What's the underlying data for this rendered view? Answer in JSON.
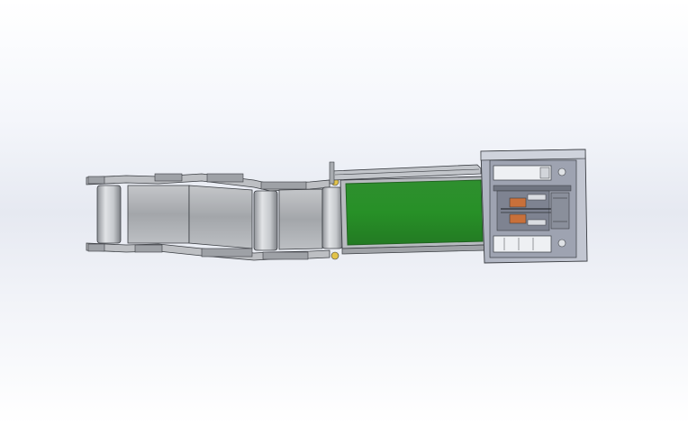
{
  "viewport": {
    "kind": "3d-cad-graphics-area",
    "background": [
      "#ffffff",
      "#e6e9f1"
    ]
  },
  "model": {
    "component_names": [
      "conveyor-frame",
      "roller-belt-section",
      "green-belt",
      "control-cabinet"
    ],
    "colors": {
      "frame_steel": "#a8abb0",
      "frame_edge": "#3a3d42",
      "roller_light": "#d9dbde",
      "roller_dark": "#8f9297",
      "green_belt": "#2e8b2e",
      "green_belt_edge": "#1f5f1f",
      "cabinet_panel": "#b7bcc9",
      "cabinet_inner": "#9ea3b1",
      "accent_orange": "#c8703a",
      "accent_yellow": "#e2c34a",
      "module_white": "#eef0f3"
    }
  }
}
